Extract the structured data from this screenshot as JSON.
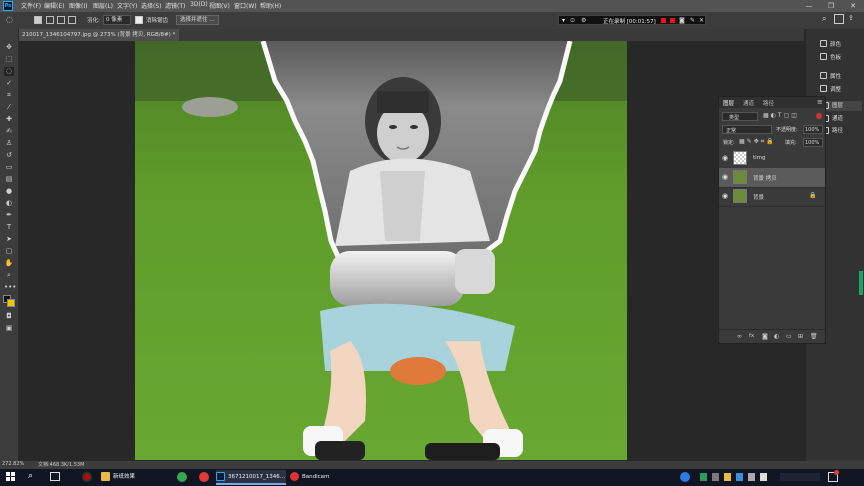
{
  "menubar": {
    "items": [
      "文件(F)",
      "编辑(E)",
      "图像(I)",
      "图层(L)",
      "文字(Y)",
      "选择(S)",
      "滤镜(T)",
      "3D(D)",
      "视图(V)",
      "窗口(W)",
      "帮助(H)"
    ],
    "controls": [
      "—",
      "❐",
      "✕"
    ]
  },
  "options": {
    "feather_label": "羽化:",
    "feather_value": "0 像素",
    "antialias_label": "消除锯齿",
    "select_mask_label": "选择并遮住 ..."
  },
  "recorder": {
    "status": "正在录制 [00:01:57]"
  },
  "document": {
    "tab_title": "210017_1346104797.jpg @ 273% (背景 拷贝, RGB/8#) *",
    "zoom": "272.82%",
    "doc_info": "文档:468.3K/1.53M"
  },
  "right_panel": {
    "items": [
      {
        "label": "颜色",
        "icon": "color-wheel-icon"
      },
      {
        "label": "色板",
        "icon": "swatches-icon"
      },
      {
        "label": "属性",
        "icon": "properties-icon"
      },
      {
        "label": "调整",
        "icon": "adjustments-icon"
      }
    ],
    "bottom_items": [
      {
        "label": "图层",
        "icon": "layers-icon"
      },
      {
        "label": "通道",
        "icon": "channels-icon"
      },
      {
        "label": "路径",
        "icon": "paths-icon"
      }
    ]
  },
  "layers_panel": {
    "tabs": [
      "图层",
      "通道",
      "路径"
    ],
    "kind_label": "类型",
    "blend_mode": "正常",
    "opacity_label": "不透明度:",
    "opacity_value": "100%",
    "lock_label": "锁定:",
    "fill_label": "填充:",
    "fill_value": "100%",
    "layers": [
      {
        "name": "timg",
        "selected": false
      },
      {
        "name": "背景 拷贝",
        "selected": true
      },
      {
        "name": "背景",
        "selected": false,
        "locked": true
      }
    ],
    "footer_icons": [
      "link-icon",
      "fx-icon",
      "mask-icon",
      "adjustment-icon",
      "group-icon",
      "new-layer-icon",
      "trash-icon"
    ]
  },
  "taskbar": {
    "items": [
      {
        "label": "新纸效果",
        "icon": "folder-icon",
        "color": "#e8b84a"
      },
      {
        "label": "3671210017_1346...",
        "icon": "photoshop-icon",
        "color": "#2fa3f7"
      },
      {
        "label": "Bandicam",
        "icon": "bandicam-icon",
        "color": "#d33"
      }
    ]
  },
  "colors": {
    "menubar": "#535353",
    "panel": "#3a3a3a",
    "accent": "#0070d8",
    "grass": "#5b9a25"
  }
}
